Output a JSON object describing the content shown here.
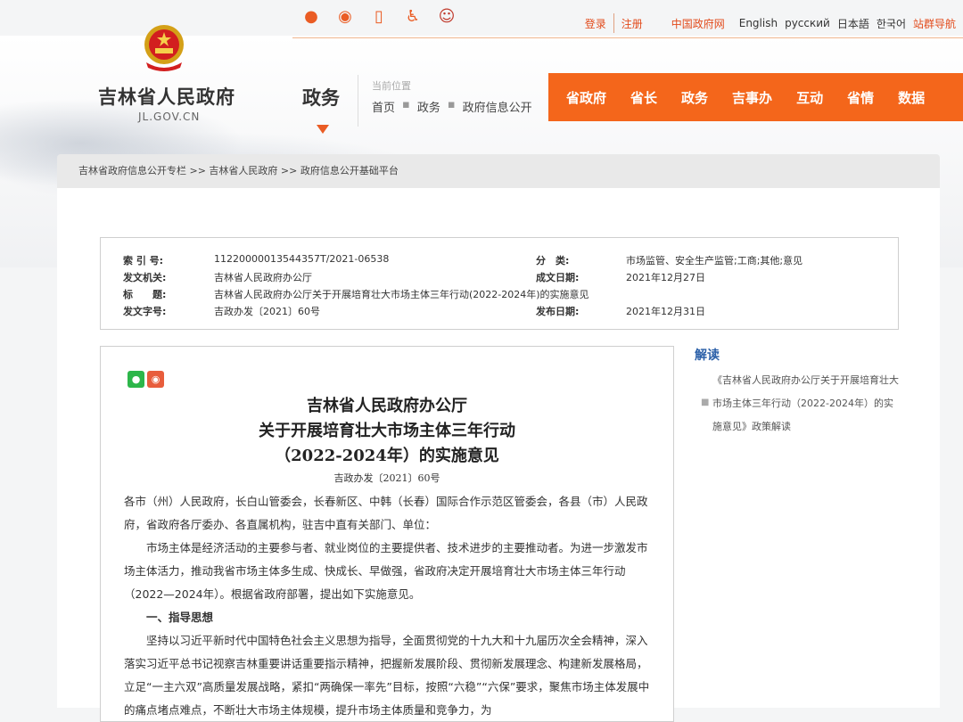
{
  "header": {
    "site_name": "吉林省人民政府",
    "site_domain": "JL.GOV.CN",
    "section": "政务",
    "location_label": "当前位置",
    "location_path": [
      "首页",
      "政务",
      "政府信息公开"
    ],
    "share_icons": [
      "wechat-icon",
      "weibo-icon",
      "mobile-icon",
      "accessibility-icon",
      "mascot-icon"
    ],
    "links": {
      "login": "登录",
      "register": "注册",
      "china_gov": "中国政府网",
      "english": "English",
      "russian": "русский",
      "japanese": "日本語",
      "korean": "한국어",
      "sitemap": "站群导航"
    },
    "nav": [
      "省政府",
      "省长",
      "政务",
      "吉事办",
      "互动",
      "省情",
      "数据"
    ]
  },
  "breadcrumb": "吉林省政府信息公开专栏 >> 吉林省人民政府 >> 政府信息公开基础平台",
  "meta": {
    "index_label": "索 引 号:",
    "index_value": "11220000013544357T/2021-06538",
    "issuer_label": "发文机关:",
    "issuer_value": "吉林省人民政府办公厅",
    "title_label": "标　　题:",
    "title_value": "吉林省人民政府办公厅关于开展培育壮大市场主体三年行动(2022-2024年)的实施意见",
    "docno_label": "发文字号:",
    "docno_value": "吉政办发〔2021〕60号",
    "category_label": "分　类:",
    "category_value": "市场监管、安全生产监管;工商;其他;意见",
    "written_label": "成文日期:",
    "written_value": "2021年12月27日",
    "published_label": "发布日期:",
    "published_value": "2021年12月31日"
  },
  "article": {
    "title_line1": "吉林省人民政府办公厅",
    "title_line2": "关于开展培育壮大市场主体三年行动",
    "title_line3": "（2022-2024年）的实施意见",
    "doc_number": "吉政办发〔2021〕60号",
    "addressee": "各市（州）人民政府，长白山管委会，长春新区、中韩（长春）国际合作示范区管委会，各县（市）人民政府，省政府各厅委办、各直属机构，驻吉中直有关部门、单位：",
    "para1": "市场主体是经济活动的主要参与者、就业岗位的主要提供者、技术进步的主要推动者。为进一步激发市场主体活力，推动我省市场主体多生成、快成长、早做强，省政府决定开展培育壮大市场主体三年行动（2022—2024年）。根据省政府部署，提出如下实施意见。",
    "heading1": "一、指导思想",
    "para2": "坚持以习近平新时代中国特色社会主义思想为指导，全面贯彻党的十九大和十九届历次全会精神，深入落实习近平总书记视察吉林重要讲话重要指示精神，把握新发展阶段、贯彻新发展理念、构建新发展格局，立足“一主六双”高质量发展战略，紧扣“两确保一率先”目标，按照“六稳”“六保”要求，聚焦市场主体发展中的痛点堵点难点，不断壮大市场主体规模，提升市场主体质量和竞争力，为"
  },
  "sidebar": {
    "title": "解读",
    "item": "《吉林省人民政府办公厅关于开展培育壮大市场主体三年行动（2022-2024年）的实施意见》政策解读"
  },
  "colors": {
    "accent": "#f4661b",
    "link_red": "#e24b1c",
    "side_blue": "#2a5fa8"
  }
}
